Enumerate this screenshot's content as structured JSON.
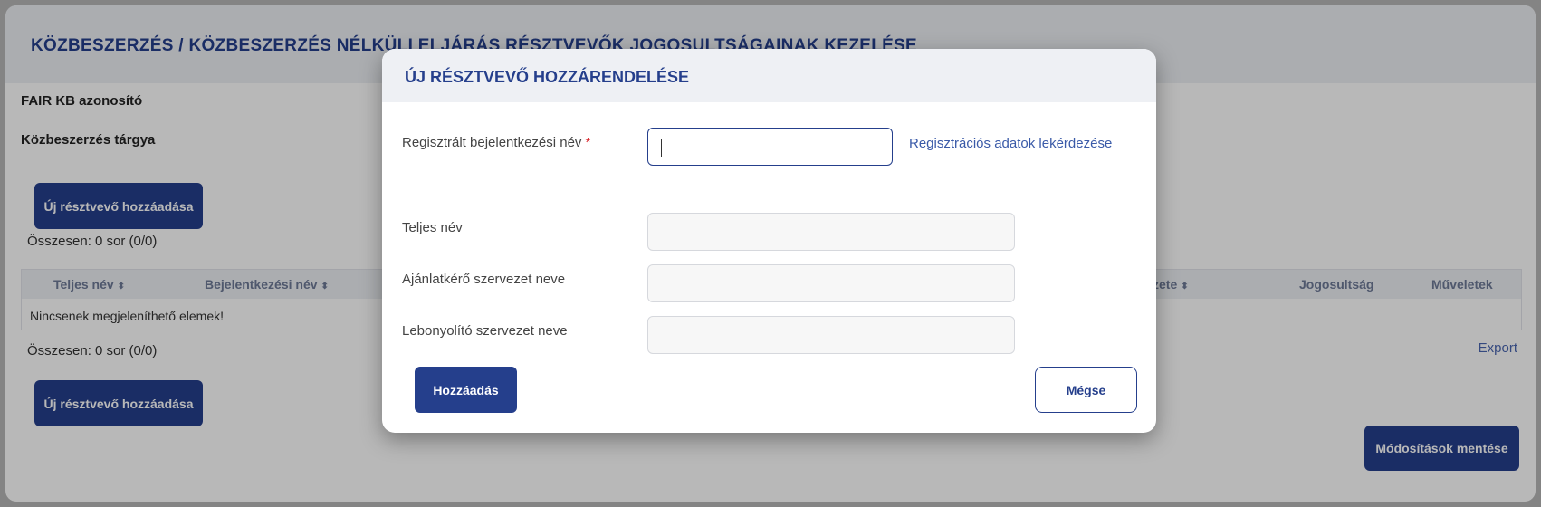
{
  "page": {
    "title": "KÖZBESZERZÉS / KÖZBESZERZÉS NÉLKÜLI ELJÁRÁS RÉSZTVEVŐK JOGOSULTSÁGAINAK KEZELÉSE",
    "fair_kb_label": "FAIR KB azonosító",
    "subject_label": "Közbeszerzés tárgya",
    "add_participant_button": "Új résztvevő hozzáadása",
    "count_top": "Összesen: 0 sor (0/0)",
    "count_bottom": "Összesen: 0 sor (0/0)",
    "export_label": "Export",
    "save_changes_button": "Módosítások mentése",
    "table": {
      "columns": [
        "Teljes név",
        "Bejelentkezési név",
        "zete",
        "Jogosultság",
        "Műveletek"
      ],
      "sort_icon": "⬍",
      "empty_message": "Nincsenek megjeleníthető elemek!"
    }
  },
  "modal": {
    "title": "ÚJ RÉSZTVEVŐ HOZZÁRENDELÉSE",
    "login_name_label": "Regisztrált bejelentkezési név",
    "required_marker": "*",
    "login_name_value": "",
    "lookup_link": "Regisztrációs adatok lekérdezése",
    "full_name_label": "Teljes név",
    "requester_org_label": "Ajánlatkérő szervezet neve",
    "organizer_org_label": "Lebonyolító szervezet neve",
    "add_button": "Hozzáadás",
    "cancel_button": "Mégse"
  },
  "colors": {
    "accent": "#253f8c",
    "header_bg": "#eef0f4",
    "required": "#d9262c"
  }
}
